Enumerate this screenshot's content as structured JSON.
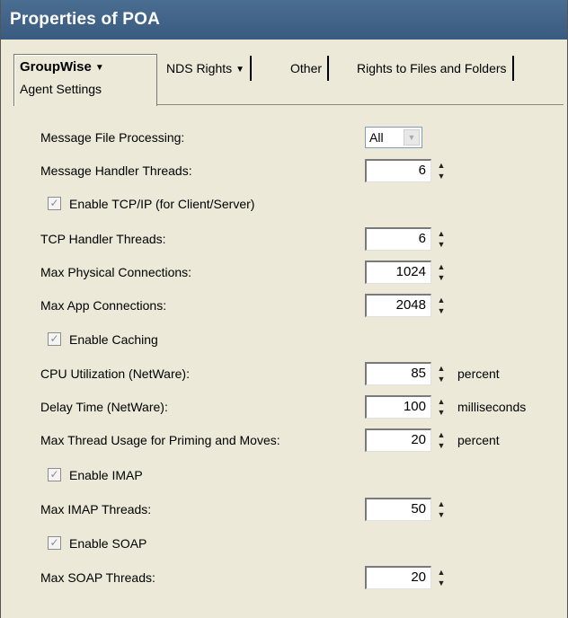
{
  "window": {
    "title": "Properties of POA"
  },
  "tabs": {
    "groupwise": {
      "label": "GroupWise",
      "sub_label": "Agent Settings"
    },
    "nds_rights": {
      "label": "NDS Rights"
    },
    "other": {
      "label": "Other"
    },
    "rights_files": {
      "label": "Rights to Files and Folders"
    }
  },
  "settings": {
    "message_file_processing": {
      "label": "Message File Processing:",
      "value": "All"
    },
    "message_handler_threads": {
      "label": "Message Handler Threads:",
      "value": "6"
    },
    "enable_tcpip": {
      "label": "Enable TCP/IP (for Client/Server)",
      "checked": true
    },
    "tcp_handler_threads": {
      "label": "TCP Handler Threads:",
      "value": "6"
    },
    "max_physical_connections": {
      "label": "Max Physical Connections:",
      "value": "1024"
    },
    "max_app_connections": {
      "label": "Max App Connections:",
      "value": "2048"
    },
    "enable_caching": {
      "label": "Enable Caching",
      "checked": true
    },
    "cpu_utilization": {
      "label": "CPU Utilization (NetWare):",
      "value": "85",
      "unit": "percent"
    },
    "delay_time": {
      "label": "Delay Time (NetWare):",
      "value": "100",
      "unit": "milliseconds"
    },
    "max_thread_usage": {
      "label": "Max Thread Usage for Priming and Moves:",
      "value": "20",
      "unit": "percent"
    },
    "enable_imap": {
      "label": "Enable IMAP",
      "checked": true
    },
    "max_imap_threads": {
      "label": "Max IMAP Threads:",
      "value": "50"
    },
    "enable_soap": {
      "label": "Enable SOAP",
      "checked": true
    },
    "max_soap_threads": {
      "label": "Max SOAP Threads:",
      "value": "20"
    }
  },
  "glyphs": {
    "dropdown": "▼",
    "spin_up": "▲",
    "spin_down": "▼",
    "check": "✓"
  }
}
